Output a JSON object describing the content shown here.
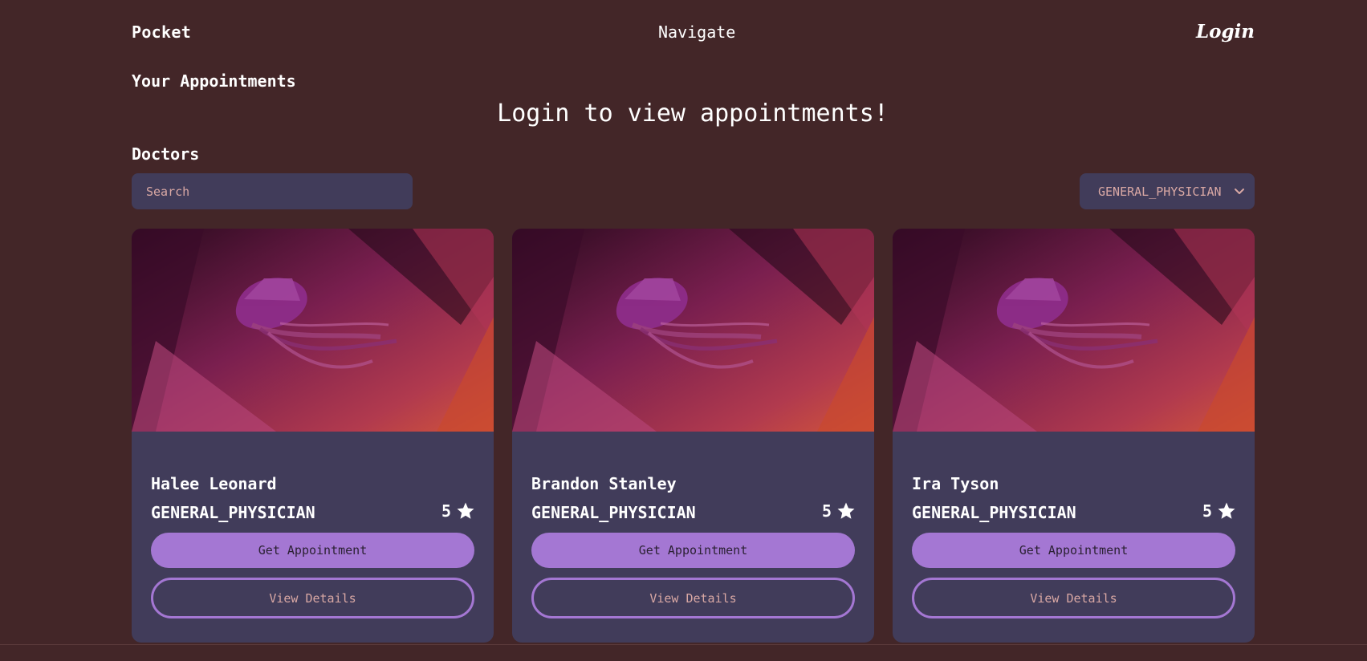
{
  "header": {
    "brand": "Pocket",
    "nav_label": "Navigate",
    "login_label": "Login"
  },
  "appointments": {
    "heading": "Your Appointments",
    "empty_message": "Login to view appointments!"
  },
  "doctors": {
    "heading": "Doctors",
    "search_placeholder": "Search",
    "filter": {
      "selected": "GENERAL_PHYSICIAN"
    },
    "cards": [
      {
        "name": "Halee Leonard",
        "specialty": "GENERAL_PHYSICIAN",
        "rating": "5",
        "primary_label": "Get Appointment",
        "secondary_label": "View Details"
      },
      {
        "name": "Brandon Stanley",
        "specialty": "GENERAL_PHYSICIAN",
        "rating": "5",
        "primary_label": "Get Appointment",
        "secondary_label": "View Details"
      },
      {
        "name": "Ira Tyson",
        "specialty": "GENERAL_PHYSICIAN",
        "rating": "5",
        "primary_label": "Get Appointment",
        "secondary_label": "View Details"
      }
    ]
  },
  "icons": {
    "rating": "star-icon",
    "filter": "chevron-down-icon"
  },
  "colors": {
    "background": "#432628",
    "panel": "#413c5a",
    "accent": "#a477d3",
    "muted_text": "#d9a8a4"
  }
}
